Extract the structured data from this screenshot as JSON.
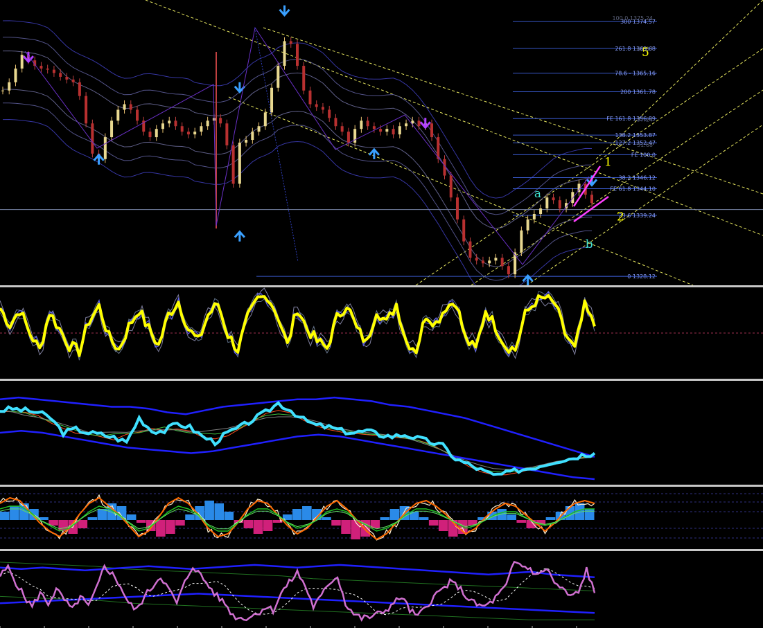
{
  "chart_data": [
    {
      "type": "line",
      "pane": "price",
      "ylim": [
        1326.5,
        1378.5
      ],
      "price_close": [
        1362.0,
        1363.5,
        1366.0,
        1368.5,
        1367.5,
        1366.5,
        1366.0,
        1365.8,
        1365.2,
        1364.5,
        1364.0,
        1363.5,
        1361.0,
        1356.0,
        1350.5,
        1349.5,
        1353.5,
        1356.5,
        1358.5,
        1359.5,
        1358.5,
        1356.5,
        1354.5,
        1353.5,
        1355.0,
        1356.0,
        1356.5,
        1355.5,
        1354.5,
        1354.0,
        1354.5,
        1355.5,
        1356.5,
        1357.0,
        1356.0,
        1352.0,
        1345.0,
        1352.5,
        1353.0,
        1354.5,
        1355.5,
        1358.0,
        1362.5,
        1366.5,
        1371.0,
        1370.5,
        1366.5,
        1362.0,
        1359.5,
        1359.0,
        1358.5,
        1357.0,
        1355.5,
        1354.5,
        1352.5,
        1355.0,
        1356.5,
        1355.5,
        1355.0,
        1354.5,
        1355.0,
        1354.0,
        1355.5,
        1356.0,
        1356.5,
        1355.5,
        1356.0,
        1353.5,
        1349.5,
        1346.5,
        1342.5,
        1338.5,
        1334.5,
        1331.5,
        1331.0,
        1330.5,
        1331.0,
        1331.5,
        1330.0,
        1328.5,
        1332.5,
        1336.5,
        1338.5,
        1339.5,
        1340.5,
        1342.5,
        1342.0,
        1340.5,
        1341.5,
        1343.5,
        1345.0,
        1343.0,
        1341.5
      ],
      "candles": 93,
      "arrows_up": [
        [
          15,
          1350.0
        ],
        [
          37,
          1336.0
        ],
        [
          58,
          1351.0
        ],
        [
          82,
          1328.0
        ]
      ],
      "arrows_down": [
        [
          4,
          1367.5
        ],
        [
          37,
          1362.0
        ],
        [
          44,
          1376.0
        ],
        [
          66,
          1355.5
        ],
        [
          93,
          1345.0
        ]
      ],
      "fib_levels": [
        {
          "label": "300 1374.57",
          "value": 1374.57
        },
        {
          "label": "261.8 1369.68",
          "value": 1369.68
        },
        {
          "label": "78.6 - 1365.16",
          "value": 1365.16
        },
        {
          "label": "200 1361.78",
          "value": 1361.78
        },
        {
          "label": "FE 161.8 1356.89",
          "value": 1356.89
        },
        {
          "label": "138.2 1353.87",
          "value": 1353.87
        },
        {
          "label": "127.2 1352.47",
          "value": 1352.47
        },
        {
          "label": "FE 100.0",
          "value": 1350.3
        },
        {
          "label": "38.2 1346.12",
          "value": 1346.12
        },
        {
          "label": "FE 61.8 1344.10",
          "value": 1344.1
        },
        {
          "label": "23.6 1339.24",
          "value": 1339.24
        },
        {
          "label": "0 1328.12",
          "value": 1328.12
        }
      ],
      "fib_faint": [
        {
          "label": "100.0 1375.24",
          "value": 1375.24
        },
        {
          "label": "69.87",
          "value": 1369.6
        },
        {
          "label": "57.24",
          "value": 1356.7
        },
        {
          "label": "51.68",
          "value": 1352.1
        }
      ],
      "horizontal_line": 1340.3,
      "wave_labels": [
        {
          "text": "5",
          "bar": 100,
          "value": 1368.3,
          "color": "#ffff00"
        },
        {
          "text": "a",
          "bar": 83,
          "value": 1342.5,
          "color": "#40e0d0"
        },
        {
          "text": "b",
          "bar": 91,
          "value": 1333.3,
          "color": "#40e0d0"
        },
        {
          "text": "1",
          "bar": 94,
          "value": 1348.3,
          "color": "#ffff00"
        },
        {
          "text": "2",
          "bar": 96,
          "value": 1338.3,
          "color": "#ffff00"
        }
      ]
    },
    {
      "type": "line",
      "pane": "oscillator",
      "ylim": [
        0,
        100
      ],
      "series": [
        {
          "color": "#ffff00",
          "values": [
            80,
            60,
            78,
            50,
            30,
            75,
            55,
            35,
            28,
            65,
            82,
            45,
            30,
            58,
            78,
            55,
            35,
            72,
            88,
            55,
            40,
            72,
            85,
            48,
            30,
            68,
            90,
            95,
            72,
            35,
            80,
            55,
            40,
            32,
            68,
            85,
            55,
            38,
            78,
            62,
            85,
            40,
            30,
            72,
            62,
            82,
            88,
            42,
            30,
            78,
            58,
            35,
            30,
            72,
            88,
            92,
            85,
            50,
            30,
            82,
            58
          ]
        }
      ],
      "zero_line": 50
    },
    {
      "type": "line",
      "pane": "bands",
      "ylim": [
        0,
        100
      ],
      "series": [
        {
          "color": "#40e0ff",
          "values": [
            74,
            76,
            74,
            72,
            66,
            50,
            54,
            50,
            48,
            45,
            40,
            66,
            52,
            52,
            60,
            56,
            46,
            40,
            50,
            56,
            64,
            72,
            82,
            74,
            64,
            58,
            56,
            52,
            50,
            52,
            48,
            46,
            48,
            44,
            40,
            36,
            22,
            16,
            10,
            4,
            6,
            10,
            12,
            16,
            20,
            22,
            26,
            28
          ]
        },
        {
          "color": "#2020ff",
          "values": [
            86,
            88,
            86,
            84,
            82,
            80,
            78,
            78,
            76,
            72,
            70,
            74,
            78,
            80,
            82,
            84,
            86,
            86,
            88,
            86,
            84,
            80,
            78,
            74,
            70,
            66,
            60,
            54,
            48,
            42,
            36,
            30,
            24
          ]
        },
        {
          "color": "#2020ff",
          "values": [
            50,
            52,
            50,
            46,
            42,
            38,
            34,
            32,
            30,
            28,
            30,
            34,
            38,
            42,
            46,
            48,
            46,
            42,
            38,
            34,
            30,
            26,
            22,
            18,
            14,
            10,
            6,
            2,
            0
          ]
        }
      ]
    },
    {
      "type": "bar",
      "pane": "macd",
      "ylim": [
        -100,
        100
      ],
      "histogram": [
        30,
        50,
        60,
        40,
        10,
        -20,
        -40,
        -50,
        -30,
        10,
        40,
        60,
        50,
        20,
        -10,
        -40,
        -60,
        -50,
        -20,
        20,
        50,
        70,
        60,
        30,
        -10,
        -30,
        -50,
        -40,
        -10,
        20,
        40,
        50,
        40,
        10,
        -20,
        -50,
        -70,
        -60,
        -30,
        10,
        40,
        50,
        30,
        10,
        -20,
        -40,
        -60,
        -50,
        -20,
        10,
        30,
        40,
        20,
        -10,
        -30,
        -20,
        10,
        30,
        50,
        60,
        40
      ],
      "series": [
        {
          "color": "#ff6a00",
          "values": [
            60,
            80,
            70,
            30,
            -10,
            -40,
            -60,
            -30,
            20,
            60,
            80,
            50,
            20,
            -20,
            -60,
            -40,
            10,
            60,
            80,
            60,
            20,
            -30,
            -60,
            -50,
            -10,
            40,
            70,
            60,
            20,
            -20,
            -50,
            -30,
            10,
            50,
            70,
            40,
            0,
            -40,
            -70,
            -50,
            -10,
            30,
            60,
            70,
            50,
            20,
            -20,
            -50,
            -30,
            10,
            40,
            60,
            50,
            20,
            -10,
            -40,
            -10,
            30,
            60,
            70,
            60
          ]
        },
        {
          "color": "#20c020",
          "values": [
            40,
            50,
            50,
            30,
            0,
            -20,
            -40,
            -30,
            0,
            30,
            50,
            40,
            20,
            -10,
            -40,
            -30,
            0,
            30,
            50,
            40,
            20,
            -20,
            -40,
            -40,
            -10,
            20,
            40,
            40,
            20,
            -10,
            -30,
            -20,
            0,
            30,
            40,
            30,
            0,
            -20,
            -40,
            -30,
            -10,
            20,
            40,
            40,
            30,
            10,
            -10,
            -30,
            -20,
            0,
            20,
            30,
            30,
            10,
            -10,
            -20,
            -10,
            10,
            30,
            40,
            40
          ]
        }
      ]
    },
    {
      "type": "line",
      "pane": "rsi",
      "ylim": [
        0,
        100
      ],
      "series": [
        {
          "color": "#d070d0",
          "values": [
            70,
            82,
            60,
            40,
            25,
            45,
            30,
            50,
            35,
            20,
            40,
            25,
            50,
            85,
            72,
            55,
            30,
            20,
            40,
            55,
            70,
            50,
            30,
            60,
            85,
            70,
            55,
            40,
            30,
            12,
            8,
            10,
            15,
            25,
            20,
            45,
            60,
            75,
            55,
            25,
            40,
            60,
            70,
            30,
            15,
            8,
            10,
            14,
            20,
            30,
            40,
            20,
            10,
            25,
            40,
            50,
            60,
            55,
            40,
            30,
            25,
            30,
            42,
            55,
            90,
            85,
            80,
            70,
            82,
            60,
            50,
            40,
            45,
            80,
            45
          ]
        },
        {
          "color": "#2020ff",
          "values": [
            82,
            80,
            82,
            80,
            78,
            80,
            82,
            84,
            82,
            80,
            82,
            84,
            86,
            84,
            82,
            84,
            86,
            84,
            82,
            80,
            78,
            76,
            74,
            72,
            74,
            76,
            72,
            70,
            68
          ]
        }
      ]
    }
  ]
}
